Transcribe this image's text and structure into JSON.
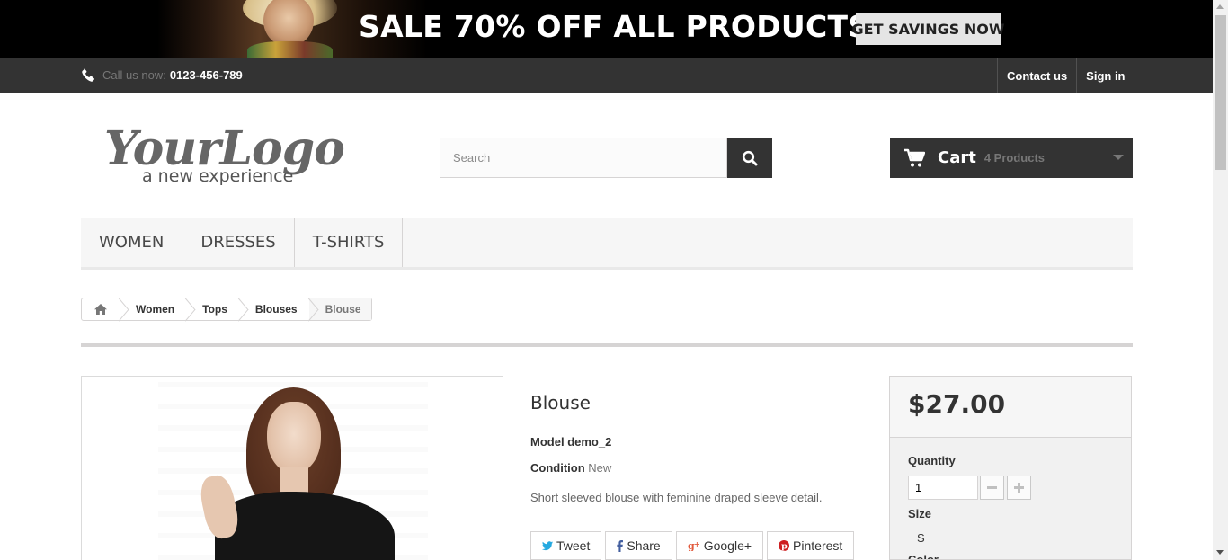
{
  "banner": {
    "text": "SALE 70% OFF ALL PRODUCTS",
    "cta": "GET SAVINGS NOW"
  },
  "topbar": {
    "call_label": "Call us now:",
    "phone": "0123-456-789",
    "links": [
      "Contact us",
      "Sign in"
    ]
  },
  "logo": {
    "name": "YourLogo",
    "tagline": "a new experience"
  },
  "search": {
    "placeholder": "Search"
  },
  "cart": {
    "title": "Cart",
    "count": "4 Products"
  },
  "menu": {
    "items": [
      "WOMEN",
      "DRESSES",
      "T-SHIRTS"
    ]
  },
  "breadcrumb": {
    "items": [
      "Women",
      "Tops",
      "Blouses"
    ],
    "current": "Blouse"
  },
  "product": {
    "title": "Blouse",
    "model_label": "Model",
    "model": "demo_2",
    "condition_label": "Condition",
    "condition": "New",
    "description": "Short sleeved blouse with feminine draped sleeve detail.",
    "share": [
      "Tweet",
      "Share",
      "Google+",
      "Pinterest"
    ]
  },
  "buybox": {
    "price": "$27.00",
    "quantity_label": "Quantity",
    "quantity": "1",
    "size_label": "Size",
    "size": "S",
    "color_label": "Color"
  }
}
